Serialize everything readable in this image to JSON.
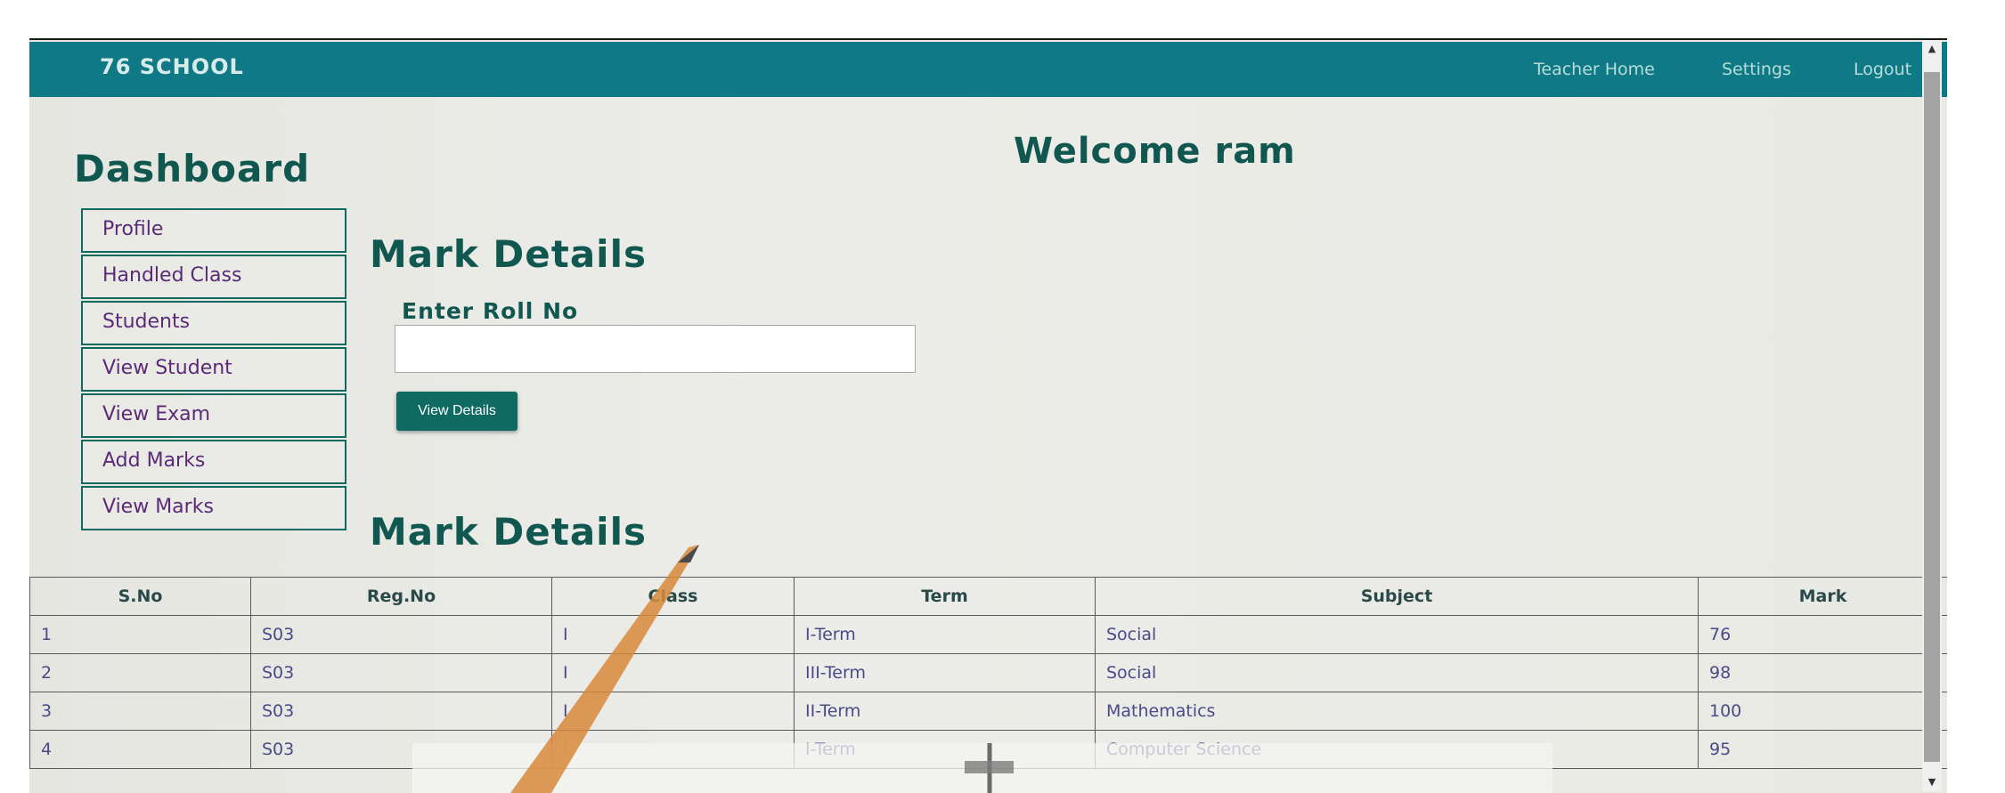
{
  "navbar": {
    "brand": "76 SCHOOL",
    "links": [
      "Teacher Home",
      "Settings",
      "Logout"
    ]
  },
  "welcome": "Welcome ram",
  "dashboard": {
    "title": "Dashboard",
    "items": [
      "Profile",
      "Handled Class",
      "Students",
      "View Student",
      "View Exam",
      "Add Marks",
      "View Marks"
    ]
  },
  "form": {
    "title": "Mark Details",
    "roll_label": "Enter Roll No",
    "roll_value": "",
    "button_label": "View Details"
  },
  "results": {
    "title": "Mark Details",
    "headers": [
      "S.No",
      "Reg.No",
      "Class",
      "Term",
      "Subject",
      "Mark"
    ],
    "rows": [
      [
        "1",
        "S03",
        "I",
        "I-Term",
        "Social",
        "76"
      ],
      [
        "2",
        "S03",
        "I",
        "III-Term",
        "Social",
        "98"
      ],
      [
        "3",
        "S03",
        "I",
        "II-Term",
        "Mathematics",
        "100"
      ],
      [
        "4",
        "S03",
        "I",
        "I-Term",
        "Computer Science",
        "95"
      ]
    ]
  },
  "colors": {
    "navbar": "#0f7986",
    "heading": "#10574f",
    "sidebar_text": "#5a2a78",
    "button": "#0f6a62"
  },
  "icons": {
    "scroll_up": "triangle-up-icon",
    "scroll_down": "triangle-down-icon"
  }
}
